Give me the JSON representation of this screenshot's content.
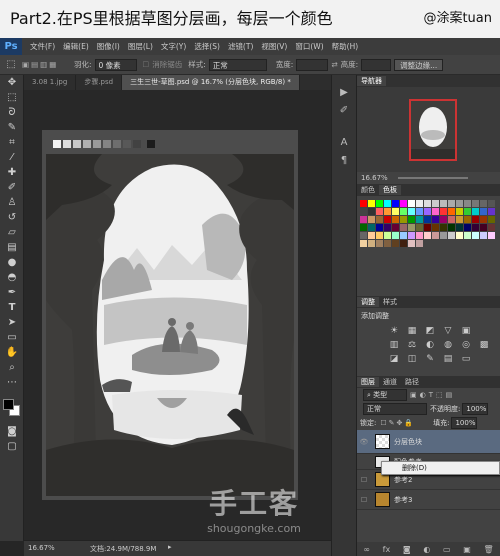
{
  "banner": {
    "title": "Part2.在PS里根据草图分层画，每层一个颜色",
    "credit": "@涂案tuan"
  },
  "app": {
    "logo": "Ps"
  },
  "menu": [
    "文件(F)",
    "编辑(E)",
    "图像(I)",
    "图层(L)",
    "文字(Y)",
    "选择(S)",
    "滤镜(T)",
    "视图(V)",
    "窗口(W)",
    "帮助(H)"
  ],
  "options": {
    "feather_label": "羽化:",
    "feather_value": "0 像素",
    "antialias": "消除锯齿",
    "style_label": "样式:",
    "style_value": "正常",
    "width_label": "宽度:",
    "height_label": "高度:",
    "refine_button": "调整边缘..."
  },
  "tabs": [
    {
      "label": "3.08 1.jpg"
    },
    {
      "label": "步骤.psd"
    },
    {
      "label": "三生三世-草图.psd @ 16.7% (分层色块, RGB/8) *"
    }
  ],
  "status": {
    "zoom": "16.67%",
    "doc": "文档:24.9M/788.9M"
  },
  "navigator": {
    "title": "导航器",
    "zoom": "16.67%"
  },
  "swatch_panel": {
    "tabs": [
      "颜色",
      "色板"
    ]
  },
  "swatch_colors": [
    "#ff0000",
    "#ffff00",
    "#00ff00",
    "#00ffff",
    "#0000ff",
    "#ff00ff",
    "#ffffff",
    "#eeeeee",
    "#dddddd",
    "#cccccc",
    "#bbbbbb",
    "#aaaaaa",
    "#999999",
    "#888888",
    "#777777",
    "#666666",
    "#555555",
    "#444444",
    "#333333",
    "#ff6060",
    "#ff9933",
    "#ffff66",
    "#66ff66",
    "#66ffff",
    "#6699ff",
    "#9966ff",
    "#ff66cc",
    "#ff3333",
    "#ff6600",
    "#cccc00",
    "#33cc33",
    "#00cccc",
    "#3366cc",
    "#6633cc",
    "#cc3399",
    "#cc9966",
    "#996633",
    "#cc0000",
    "#cc6600",
    "#999900",
    "#009900",
    "#009999",
    "#003399",
    "#330099",
    "#990066",
    "#cc6666",
    "#cc9933",
    "#996600",
    "#990000",
    "#993300",
    "#666600",
    "#006600",
    "#006666",
    "#000099",
    "#330066",
    "#660033",
    "#996666",
    "#999966",
    "#666633",
    "#660000",
    "#663300",
    "#333300",
    "#003300",
    "#003333",
    "#000066",
    "#330033",
    "#440022",
    "#663333",
    "#666666",
    "#ffcc99",
    "#ffcc66",
    "#ccff99",
    "#99ffcc",
    "#99ccff",
    "#cc99ff",
    "#ff99cc",
    "#ffcccc",
    "#cc9999",
    "#999999",
    "#cccccc",
    "#ffffcc",
    "#ccffcc",
    "#ccffff",
    "#ccccff",
    "#ffccff",
    "#f0d0a0",
    "#d0b080",
    "#a08060",
    "#806040",
    "#604020",
    "#402010",
    "#e0c0c0",
    "#c0a0a0"
  ],
  "adjust_panel": {
    "tabs": [
      "调整",
      "样式"
    ],
    "title": "添加调整"
  },
  "adjust_rows": [
    [
      "☀",
      "▦",
      "◩",
      "▽",
      "▣"
    ],
    [
      "▥",
      "⚖",
      "◐",
      "◍",
      "◎",
      "▩"
    ],
    [
      "◪",
      "◫",
      "✎",
      "▤",
      "▭"
    ]
  ],
  "layers_panel": {
    "tabs": [
      "图层",
      "通道",
      "路径"
    ],
    "kind": "类型",
    "blend": "正常",
    "opacity_label": "不透明度:",
    "opacity": "100%",
    "lock_label": "锁定:",
    "fill_label": "填充:",
    "fill": "100%"
  },
  "layers": [
    {
      "name": "分层色块",
      "selected": true
    },
    {
      "name": "配色参考",
      "selected": false
    },
    {
      "name": "参考2",
      "selected": false
    },
    {
      "name": "参考3",
      "selected": false
    }
  ],
  "context_menu": {
    "item": "删除(D)"
  },
  "watermark": {
    "title": "手工客",
    "url": "shougongke.com"
  },
  "colors": {
    "dark_bg": "#282828",
    "doc_bg": "#4c4c4c",
    "light": "#f2f2f2",
    "red": "#cc3333"
  }
}
